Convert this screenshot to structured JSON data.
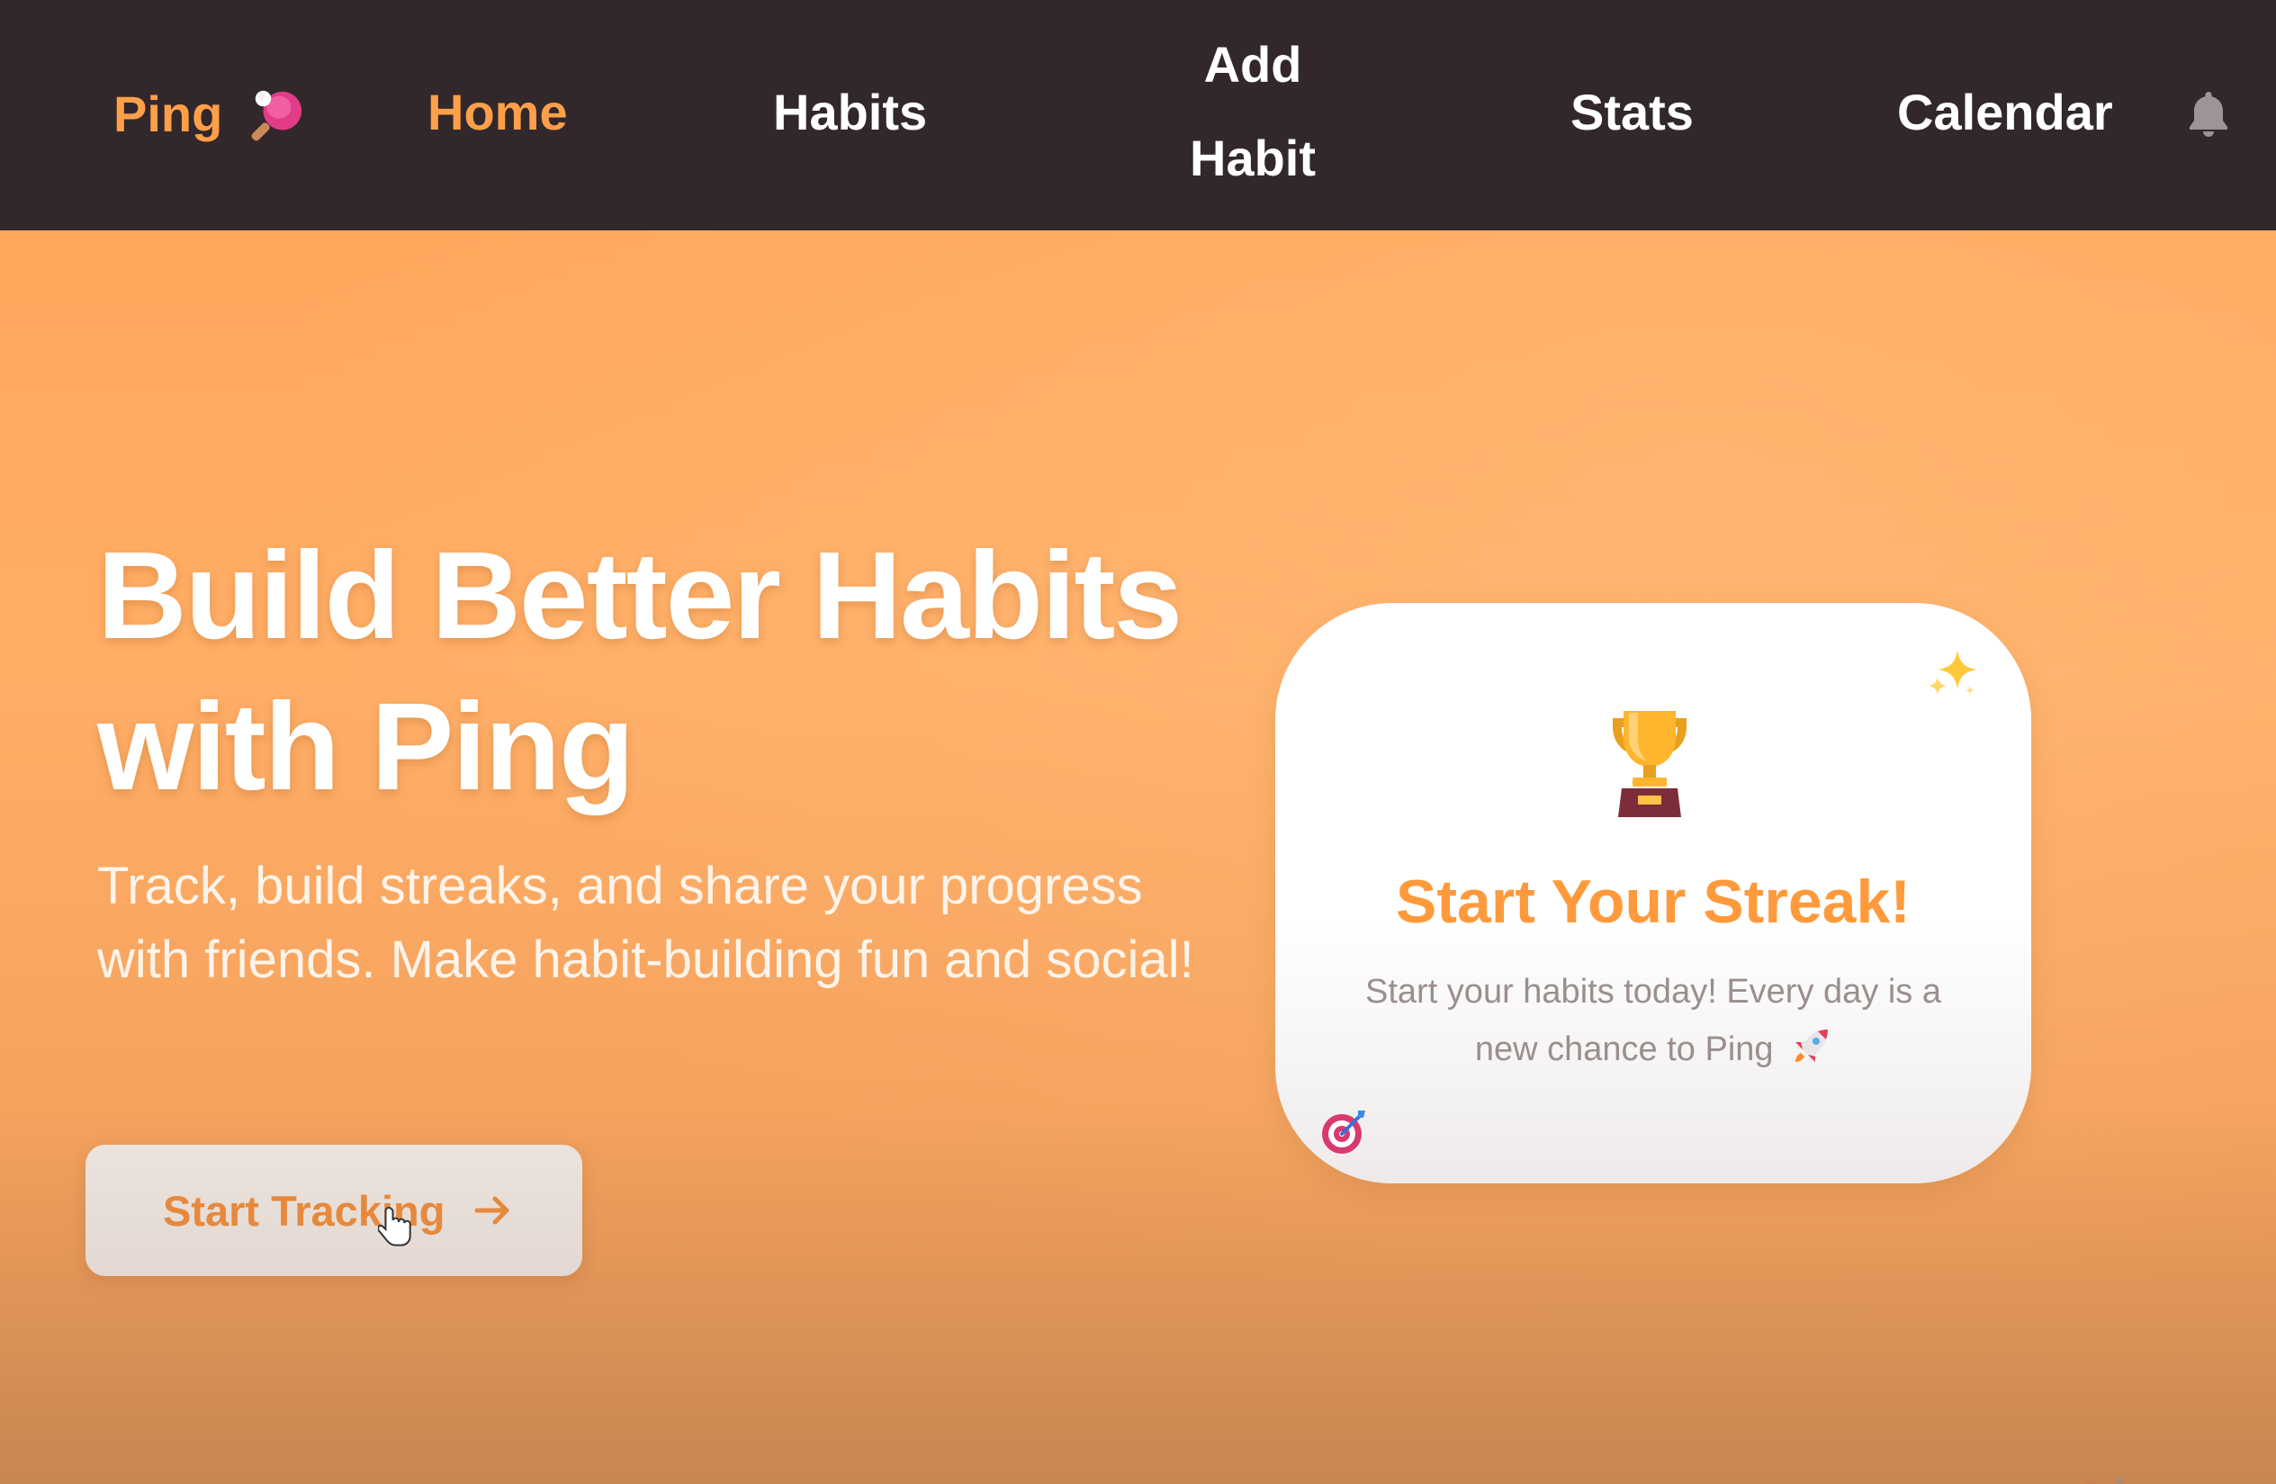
{
  "nav": {
    "brand": "Ping",
    "brand_icon": "ping-pong-paddle-icon",
    "items": {
      "home": "Home",
      "habits": "Habits",
      "add_habit": "Add Habit",
      "stats": "Stats",
      "calendar": "Calendar"
    },
    "active_item": "Home",
    "notification_icon": "bell-icon"
  },
  "hero": {
    "title": "Build Better Habits with Ping",
    "subtitle": "Track, build streaks, and share your progress with friends. Make habit-building fun and social!",
    "cta_label": "Start Tracking",
    "cta_icon": "arrow-right-icon"
  },
  "card": {
    "title": "Start Your Streak!",
    "text": "Start your habits today! Every day is a new chance to Ping",
    "icons": [
      "trophy-icon",
      "sparkles-icon",
      "rocket-icon",
      "dart-target-icon"
    ]
  },
  "colors": {
    "navbar_bg": "#32282b",
    "accent_orange": "#ff9f4a",
    "hero_bg": "#ffa75b",
    "card_title": "#ff9a3c",
    "cta_text": "#e6893c"
  }
}
